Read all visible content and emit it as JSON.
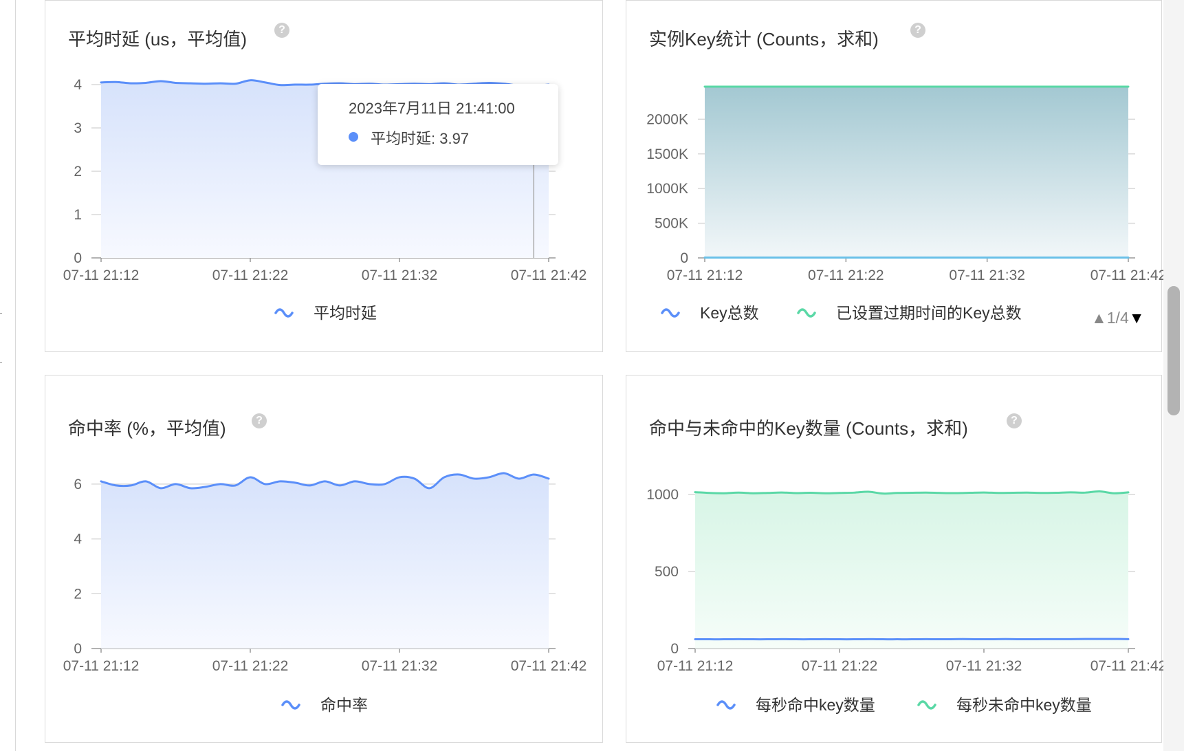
{
  "colors": {
    "blue": "#5b8ff9",
    "green": "#5ad8a6",
    "teal_fill": "#8fbfca",
    "axis": "#999999",
    "grid": "#d9d9d9"
  },
  "panels": [
    {
      "title": "平均时延 (us，平均值)",
      "help_icon": "question-circle-icon",
      "legend": [
        {
          "name": "平均时延",
          "color": "#5b8ff9",
          "icon": "wave-icon"
        }
      ]
    },
    {
      "title": "实例Key统计 (Counts，求和)",
      "help_icon": "question-circle-icon",
      "legend": [
        {
          "name": "Key总数",
          "color": "#5b8ff9",
          "icon": "wave-icon"
        },
        {
          "name": "已设置过期时间的Key总数",
          "color": "#5ad8a6",
          "icon": "wave-icon"
        }
      ],
      "pager": {
        "text": "1/4",
        "up": "▲",
        "down": "▼"
      }
    },
    {
      "title": "命中率 (%，平均值)",
      "help_icon": "question-circle-icon",
      "legend": [
        {
          "name": "命中率",
          "color": "#5b8ff9",
          "icon": "wave-icon"
        }
      ]
    },
    {
      "title": "命中与未命中的Key数量 (Counts，求和)",
      "help_icon": "question-circle-icon",
      "legend": [
        {
          "name": "每秒命中key数量",
          "color": "#5b8ff9",
          "icon": "wave-icon"
        },
        {
          "name": "每秒未命中key数量",
          "color": "#5ad8a6",
          "icon": "wave-icon"
        }
      ]
    }
  ],
  "tooltip": {
    "time": "2023年7月11日 21:41:00",
    "label": "平均时延: 3.97"
  },
  "chart_data": [
    {
      "type": "area",
      "title": "平均时延 (us，平均值)",
      "x_ticks": [
        "07-11 21:12",
        "07-11 21:22",
        "07-11 21:32",
        "07-11 21:42"
      ],
      "x_range_minutes": [
        0,
        30
      ],
      "ylim": [
        0,
        4
      ],
      "y_ticks": [
        "0",
        "1",
        "2",
        "3",
        "4"
      ],
      "y_tick_values": [
        0,
        1,
        2,
        3,
        4
      ],
      "hover_x_minute": 29,
      "series": [
        {
          "name": "平均时延",
          "color": "#5b8ff9",
          "values": [
            4.05,
            4.06,
            4.03,
            4.04,
            4.08,
            4.04,
            4.03,
            4.02,
            4.03,
            4.02,
            4.1,
            4.05,
            3.99,
            4.0,
            4.0,
            4.02,
            4.03,
            4.01,
            4.02,
            4.0,
            4.01,
            4.02,
            4.01,
            4.03,
            4.0,
            4.02,
            4.04,
            4.02,
            3.98,
            3.97,
            4.0
          ]
        }
      ]
    },
    {
      "type": "area",
      "title": "实例Key统计 (Counts，求和)",
      "x_ticks": [
        "07-11 21:12",
        "07-11 21:22",
        "07-11 21:32",
        "07-11 21:42"
      ],
      "x_range_minutes": [
        0,
        30
      ],
      "ylim": [
        0,
        2500
      ],
      "y_ticks": [
        "0",
        "500K",
        "1000K",
        "1500K",
        "2000K"
      ],
      "y_tick_values": [
        0,
        500,
        1000,
        1500,
        2000
      ],
      "series": [
        {
          "name": "Key总数",
          "color": "#5b8ff9",
          "values": [
            2470,
            2470,
            2470,
            2470,
            2470,
            2470,
            2470,
            2470,
            2470,
            2470,
            2470,
            2470,
            2470,
            2470,
            2470,
            2470,
            2470,
            2470,
            2470,
            2470,
            2470,
            2470,
            2470,
            2470,
            2470,
            2470,
            2470,
            2470,
            2470,
            2470,
            2470
          ]
        },
        {
          "name": "已设置过期时间的Key总数",
          "color": "#5ad8a6",
          "values": [
            5,
            5,
            5,
            5,
            5,
            5,
            5,
            5,
            5,
            5,
            5,
            5,
            5,
            5,
            5,
            5,
            5,
            5,
            5,
            5,
            5,
            5,
            5,
            5,
            5,
            5,
            5,
            5,
            5,
            5,
            5
          ]
        }
      ]
    },
    {
      "type": "area",
      "title": "命中率 (%，平均值)",
      "x_ticks": [
        "07-11 21:12",
        "07-11 21:22",
        "07-11 21:32",
        "07-11 21:42"
      ],
      "x_range_minutes": [
        0,
        30
      ],
      "ylim": [
        0,
        6.6
      ],
      "y_ticks": [
        "0",
        "2",
        "4",
        "6"
      ],
      "y_tick_values": [
        0,
        2,
        4,
        6
      ],
      "series": [
        {
          "name": "命中率",
          "color": "#5b8ff9",
          "values": [
            6.1,
            5.95,
            5.95,
            6.1,
            5.85,
            6.0,
            5.85,
            5.9,
            6.0,
            5.95,
            6.25,
            6.0,
            6.1,
            6.05,
            5.95,
            6.1,
            5.95,
            6.1,
            6.0,
            6.0,
            6.25,
            6.2,
            5.85,
            6.25,
            6.35,
            6.2,
            6.25,
            6.4,
            6.2,
            6.35,
            6.2
          ]
        }
      ]
    },
    {
      "type": "area",
      "title": "命中与未命中的Key数量 (Counts，求和)",
      "x_ticks": [
        "07-11 21:12",
        "07-11 21:22",
        "07-11 21:32",
        "07-11 21:42"
      ],
      "x_range_minutes": [
        0,
        30
      ],
      "ylim": [
        0,
        1000
      ],
      "y_ticks": [
        "0",
        "500",
        "1000"
      ],
      "y_tick_values": [
        0,
        500,
        1000
      ],
      "series": [
        {
          "name": "每秒命中key数量",
          "color": "#5b8ff9",
          "values": [
            60,
            60,
            60,
            61,
            60,
            60,
            61,
            60,
            60,
            61,
            60,
            60,
            61,
            60,
            60,
            60,
            61,
            60,
            61,
            61,
            60,
            61,
            61,
            60,
            61,
            61,
            61,
            62,
            62,
            62,
            61
          ]
        },
        {
          "name": "每秒未命中key数量",
          "color": "#5ad8a6",
          "values": [
            1015,
            1010,
            1008,
            1012,
            1008,
            1010,
            1013,
            1009,
            1011,
            1008,
            1010,
            1012,
            1018,
            1006,
            1010,
            1011,
            1012,
            1010,
            1009,
            1011,
            1013,
            1010,
            1011,
            1012,
            1010,
            1011,
            1014,
            1012,
            1020,
            1008,
            1014
          ]
        }
      ]
    }
  ]
}
